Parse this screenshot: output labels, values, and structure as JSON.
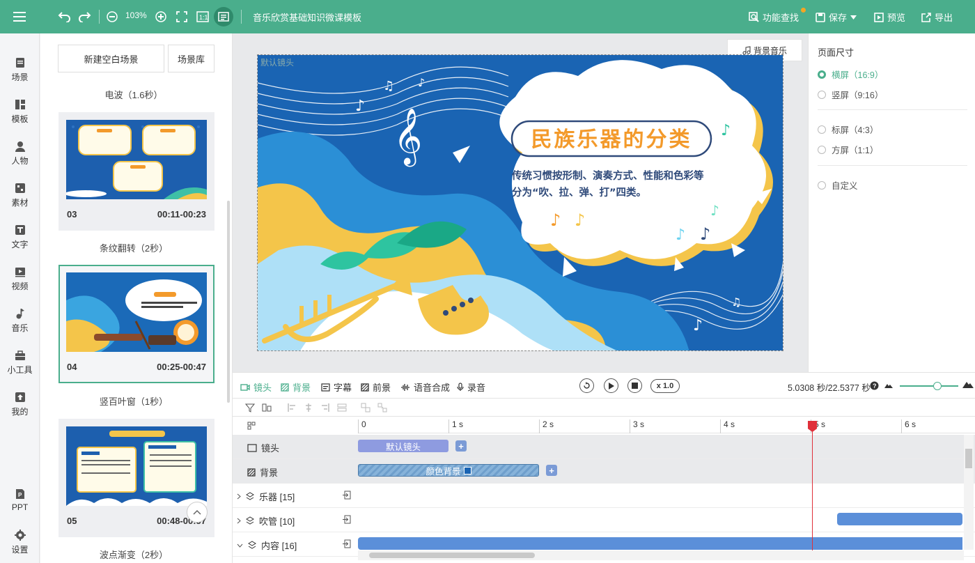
{
  "topbar": {
    "zoom": "103%",
    "title": "音乐欣赏基础知识微课模板",
    "feature_search": "功能查找",
    "save": "保存",
    "preview": "预览",
    "export": "导出"
  },
  "nav": [
    {
      "label": "场景",
      "icon": "scene-icon"
    },
    {
      "label": "模板",
      "icon": "template-icon"
    },
    {
      "label": "人物",
      "icon": "person-icon"
    },
    {
      "label": "素材",
      "icon": "material-icon"
    },
    {
      "label": "文字",
      "icon": "text-icon"
    },
    {
      "label": "视频",
      "icon": "video-icon"
    },
    {
      "label": "音乐",
      "icon": "music-icon"
    },
    {
      "label": "小工具",
      "icon": "toolbox-icon"
    },
    {
      "label": "我的",
      "icon": "upload-icon"
    },
    {
      "label": "PPT",
      "icon": "ppt-icon"
    },
    {
      "label": "设置",
      "icon": "gear-icon"
    }
  ],
  "scenes_panel": {
    "new_blank": "新建空白场景",
    "library": "场景库",
    "transitions": [
      "电波（1.6秒）",
      "条纹翻转（2秒）",
      "竖百叶窗（1秒）",
      "波点渐变（2秒）"
    ],
    "cards": [
      {
        "num": "03",
        "time": "00:11-00:23"
      },
      {
        "num": "04",
        "time": "00:25-00:47"
      },
      {
        "num": "05",
        "time": "00:48-00:57"
      }
    ]
  },
  "stage": {
    "bgm": "背景音乐",
    "camera_tag": "默认镜头",
    "slide_title": "民族乐器的分类",
    "slide_body_1": "传统习惯按形制、演奏方式、性能和色彩等",
    "slide_body_2": "分为“吹、拉、弹、打”四类。"
  },
  "props": {
    "heading": "页面尺寸",
    "options": [
      "横屏（16:9）",
      "竖屏（9:16）",
      "标屏（4:3）",
      "方屏（1:1）",
      "自定义"
    ],
    "selected": 0
  },
  "timeline": {
    "tabs": [
      "镜头",
      "背景",
      "字幕",
      "前景",
      "语音合成",
      "录音"
    ],
    "speed": "x 1.0",
    "timecode": "5.0308 秒/22.5377 秒",
    "ticks": [
      "0",
      "1 s",
      "2 s",
      "3 s",
      "4 s",
      "5 s",
      "6 s"
    ],
    "rows": [
      {
        "label": "镜头"
      },
      {
        "label": "背景"
      },
      {
        "label": "乐器 [15]"
      },
      {
        "label": "吹管 [10]"
      },
      {
        "label": "内容 [16]"
      }
    ],
    "camera_clip": "默认镜头",
    "bg_clip": "颜色背景"
  },
  "colors": {
    "accent": "#4aae8c",
    "clip_blue": "#5b8fd9",
    "playhead": "#e0303a"
  }
}
